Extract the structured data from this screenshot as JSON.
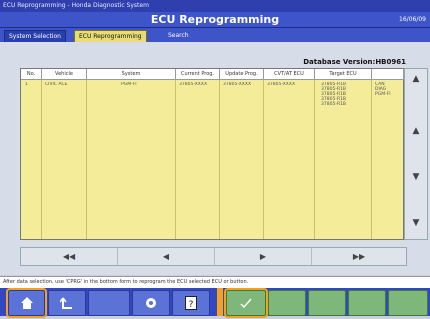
{
  "window": {
    "title": "ECU Reprogramming - Honda Diagnostic System"
  },
  "header": {
    "title": "ECU Reprogramming",
    "date": "16/06/09"
  },
  "tabs": [
    {
      "label": "System Selection"
    },
    {
      "label": "ECU Reprogramming"
    },
    {
      "label": "Search"
    }
  ],
  "database": {
    "version_label": "Database Version:HB0961"
  },
  "table": {
    "columns": [
      "No.",
      "Vehicle",
      "System",
      "Current Prog.",
      "Update Prog.",
      "CVT/AT ECU",
      "Target ECU",
      ""
    ],
    "row": {
      "no": "1",
      "vehicle": "CIVIC ACE",
      "system": "PGM-FI",
      "current": "37805-XXXX",
      "update": "37805-XXXX",
      "cvt": "37805-XXXX",
      "target_lines": [
        "37805-R1B",
        "37805-R1B",
        "37805-R1B",
        "37805-R1B",
        "37805-R1B"
      ],
      "extra_lines": [
        "CAN",
        "DIAG",
        "PGM-FI"
      ]
    }
  },
  "scroll": {
    "top": "▲",
    "up": "▲",
    "down": "▼",
    "bottom": "▼"
  },
  "pager": {
    "first": "◀◀",
    "prev": "◀",
    "next": "▶",
    "last": "▶▶"
  },
  "status": {
    "text": "After data selection, use 'CPRG' in the bottom form to reprogram the ECU selected ECU or button."
  },
  "toolbar": [
    {
      "icon": "home-icon"
    },
    {
      "icon": "back-icon"
    },
    {
      "icon": "tools-icon"
    },
    {
      "icon": "help-icon"
    },
    {
      "icon": "check-icon"
    }
  ]
}
